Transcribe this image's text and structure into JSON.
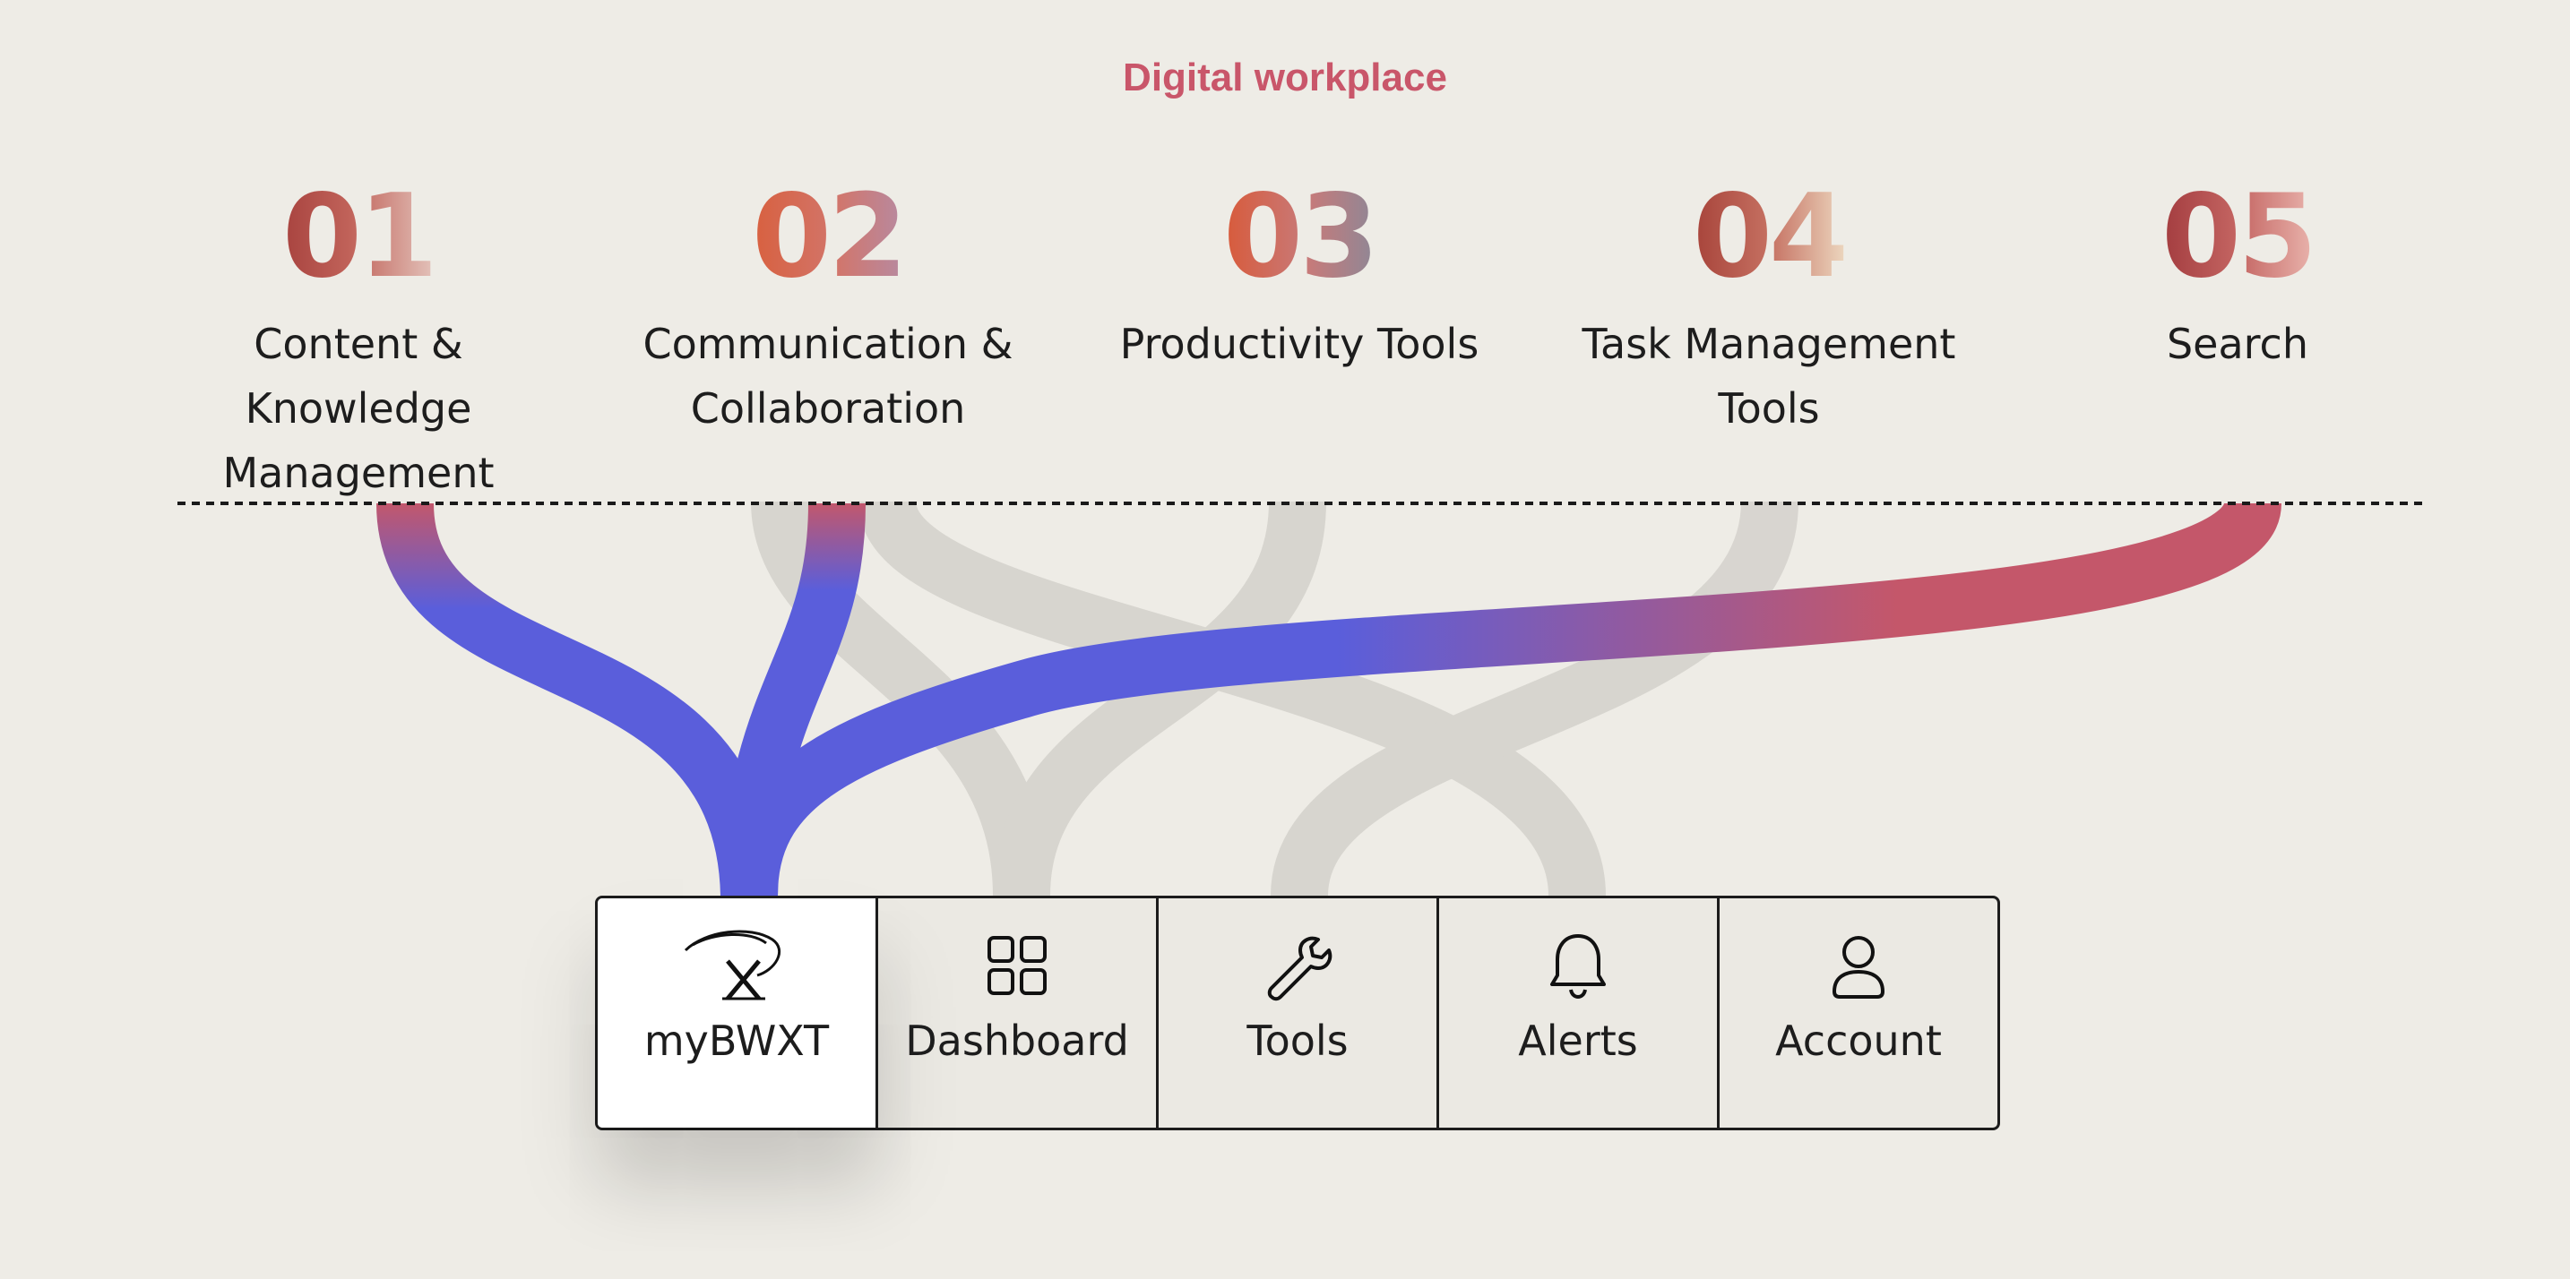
{
  "title": "Digital workplace",
  "categories": [
    {
      "number": "01",
      "label_line1": "Content & Knowledge",
      "label_line2": "Management"
    },
    {
      "number": "02",
      "label_line1": "Communication &",
      "label_line2": "Collaboration"
    },
    {
      "number": "03",
      "label_line1": "Productivity Tools",
      "label_line2": ""
    },
    {
      "number": "04",
      "label_line1": "Task Management",
      "label_line2": "Tools"
    },
    {
      "number": "05",
      "label_line1": "Search",
      "label_line2": ""
    }
  ],
  "nav": {
    "items": [
      {
        "label": "myBWXT",
        "icon": "bwxt-logo-icon",
        "active": true
      },
      {
        "label": "Dashboard",
        "icon": "grid-icon",
        "active": false
      },
      {
        "label": "Tools",
        "icon": "wrench-icon",
        "active": false
      },
      {
        "label": "Alerts",
        "icon": "bell-icon",
        "active": false
      },
      {
        "label": "Account",
        "icon": "user-icon",
        "active": false
      }
    ]
  },
  "colors": {
    "accent_title": "#c9566a",
    "flow_highlight_start": "#c4576a",
    "flow_highlight_end": "#5a5edb",
    "flow_inactive": "#d3d1cb",
    "background": "#eeece6"
  }
}
